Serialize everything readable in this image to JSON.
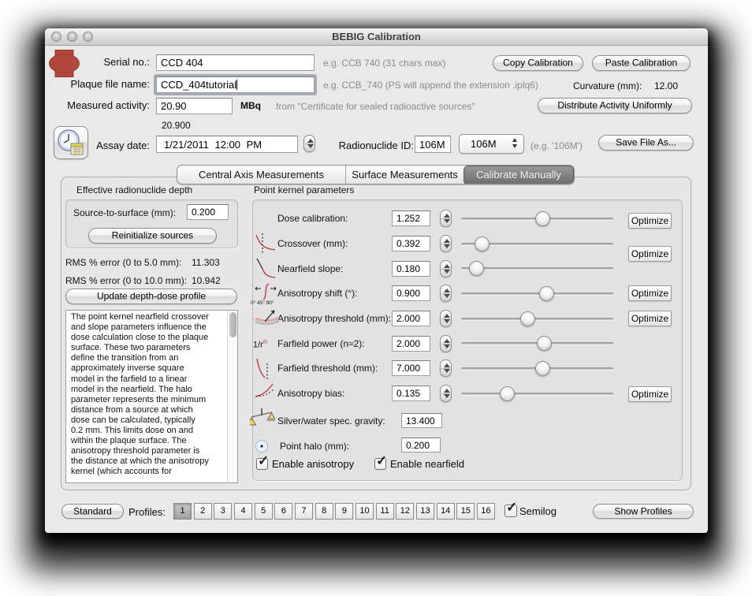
{
  "window": {
    "title": "BEBIG Calibration"
  },
  "header": {
    "serial": {
      "label": "Serial no.:",
      "value": "CCD 404",
      "hint": "e.g. CCB 740 (31 chars max)"
    },
    "plaque": {
      "label": "Plaque file name:",
      "value": "CCD_404tutorial",
      "hint": "e.g. CCB_740 (PS will append the extension .iplq6)"
    },
    "activity": {
      "label": "Measured activity:",
      "value": "20.90",
      "unit": "MBq",
      "hint": "from \"Certificate for sealed radioactive sources\"",
      "readout": "20.900"
    },
    "copy_btn": "Copy Calibration",
    "paste_btn": "Paste Calibration",
    "curvature_label": "Curvature (mm):",
    "curvature_value": "12.00",
    "distribute_btn": "Distribute Activity Uniformly",
    "assay": {
      "label": "Assay date:",
      "value": "1/21/2011 12:00 PM"
    },
    "radionuclide": {
      "label": "Radionuclide ID:",
      "value": "106M",
      "popup_value": "106M",
      "hint": "(e.g. '106M')"
    },
    "save_btn": "Save File As..."
  },
  "tabs": [
    {
      "label": "Central Axis Measurements",
      "selected": false
    },
    {
      "label": "Surface Measurements",
      "selected": false
    },
    {
      "label": "Calibrate Manually",
      "selected": true
    }
  ],
  "left": {
    "section_label": "Effective radionuclide depth",
    "sts_label": "Source-to-surface (mm):",
    "sts_value": "0.200",
    "reinit_btn": "Reinitialize sources",
    "rms1_label": "RMS % error (0 to 5.0 mm):",
    "rms1_value": "11.303",
    "rms2_label": "RMS % error (0 to 10.0 mm):",
    "rms2_value": "10.942",
    "update_btn": "Update depth-dose profile",
    "description": "The point kernel nearfield crossover and slope parameters influence the dose calculation close to the plaque surface. These two parameters define the transition from an approximately inverse square model in the farfield to a linear model in the nearfield. The halo parameter represents the minimum distance from a source at which dose can be calculated, typically 0.2 mm. This limits dose on and within the plaque surface. The anisotropy threshold parameter is the distance at which the anisotropy kernel (which accounts for"
  },
  "params": {
    "section_label": "Point kernel parameters",
    "optimize_label": "Optimize",
    "rows": [
      {
        "label": "Dose calibration:",
        "value": "1.252",
        "slider": 0.54
      },
      {
        "label": "Crossover (mm):",
        "value": "0.392",
        "slider": 0.1
      },
      {
        "label": "Nearfield slope:",
        "value": "0.180",
        "slider": 0.06
      },
      {
        "label": "Anisotropy shift (°):",
        "value": "0.900",
        "slider": 0.57,
        "icon_caption": "0° 45° 90°"
      },
      {
        "label": "Anisotropy threshold (mm):",
        "value": "2.000",
        "slider": 0.43
      },
      {
        "label": "Farfield power (n≈2):",
        "value": "2.000",
        "slider": 0.55,
        "icon_text": "1/r",
        "icon_sup": "n"
      },
      {
        "label": "Farfield threshold (mm):",
        "value": "7.000",
        "slider": 0.54
      },
      {
        "label": "Anisotropy bias:",
        "value": "0.135",
        "slider": 0.28
      }
    ],
    "gravity": {
      "label": "Silver/water spec. gravity:",
      "value": "13.400"
    },
    "halo": {
      "label": "Point halo (mm):",
      "value": "0.200"
    },
    "enable_anisotropy": "Enable anisotropy",
    "enable_nearfield": "Enable nearfield"
  },
  "footer": {
    "standard_btn": "Standard",
    "profiles_label": "Profiles:",
    "profiles": [
      "1",
      "2",
      "3",
      "4",
      "5",
      "6",
      "7",
      "8",
      "9",
      "10",
      "11",
      "12",
      "13",
      "14",
      "15",
      "16"
    ],
    "selected_profile_index": 0,
    "semilog_label": "Semilog",
    "show_btn": "Show Profiles"
  }
}
